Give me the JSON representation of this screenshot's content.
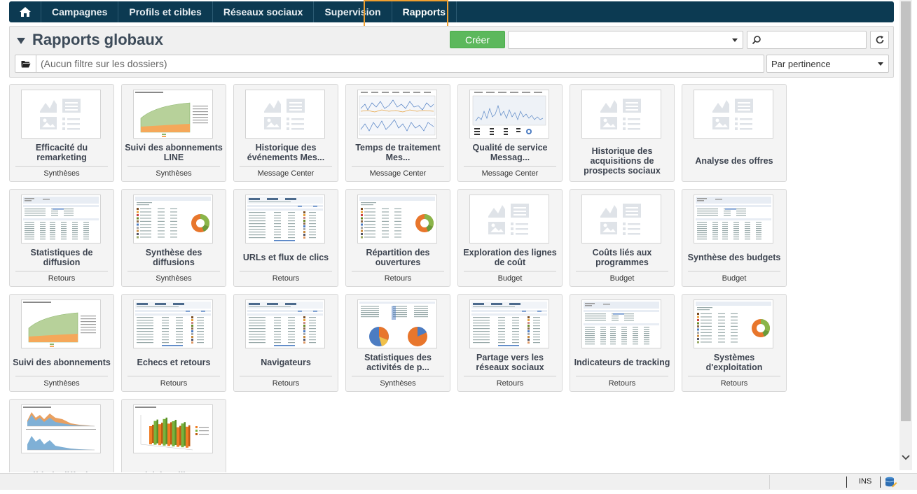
{
  "nav": {
    "home_icon": "home-icon",
    "tabs": [
      {
        "label": "Campagnes"
      },
      {
        "label": "Profils et cibles"
      },
      {
        "label": "Réseaux sociaux"
      },
      {
        "label": "Supervision"
      },
      {
        "label": "Rapports",
        "active": true
      }
    ]
  },
  "header": {
    "title": "Rapports globaux",
    "create_label": "Créer",
    "folder_filter": "(Aucun filtre sur les dossiers)",
    "sort_value": "Par pertinence",
    "type_select_value": ""
  },
  "cards": [
    {
      "title": "Efficacité du remarketing",
      "category": "Synthèses",
      "thumb": "placeholder"
    },
    {
      "title": "Suivi des abonnements LINE",
      "category": "Synthèses",
      "thumb": "area"
    },
    {
      "title": "Historique des événements Mes...",
      "category": "Message Center",
      "thumb": "placeholder"
    },
    {
      "title": "Temps de traitement Mes...",
      "category": "Message Center",
      "thumb": "timeseries"
    },
    {
      "title": "Qualité de service Messag...",
      "category": "Message Center",
      "thumb": "quality"
    },
    {
      "title": "Historique des acquisitions de prospects sociaux",
      "category": "",
      "thumb": "placeholder"
    },
    {
      "title": "Analyse des offres",
      "category": "",
      "thumb": "placeholder"
    },
    {
      "title": "Statistiques de diffusion",
      "category": "Retours",
      "thumb": "table"
    },
    {
      "title": "Synthèse des diffusions",
      "category": "Synthèses",
      "thumb": "donut"
    },
    {
      "title": "URLs et flux de clics",
      "category": "Retours",
      "thumb": "stats"
    },
    {
      "title": "Répartition des ouvertures",
      "category": "Retours",
      "thumb": "donut"
    },
    {
      "title": "Exploration des lignes de coût",
      "category": "Budget",
      "thumb": "placeholder"
    },
    {
      "title": "Coûts liés aux programmes",
      "category": "Budget",
      "thumb": "placeholder"
    },
    {
      "title": "Synthèse des budgets",
      "category": "Budget",
      "thumb": "table"
    },
    {
      "title": "Suivi des abonnements",
      "category": "Synthèses",
      "thumb": "area"
    },
    {
      "title": "Echecs et retours",
      "category": "Retours",
      "thumb": "stats"
    },
    {
      "title": "Navigateurs",
      "category": "Retours",
      "thumb": "stats"
    },
    {
      "title": "Statistiques des activités de p...",
      "category": "Synthèses",
      "thumb": "pies"
    },
    {
      "title": "Partage vers les réseaux sociaux",
      "category": "Retours",
      "thumb": "stats"
    },
    {
      "title": "Indicateurs de tracking",
      "category": "Retours",
      "thumb": "table"
    },
    {
      "title": "Systèmes d'exploitation",
      "category": "Retours",
      "thumb": "donut"
    },
    {
      "title": "Débit de diffusion",
      "category": "",
      "thumb": "mountain"
    },
    {
      "title": "Activités utilisateurs",
      "category": "",
      "thumb": "bars3d"
    }
  ],
  "status": {
    "mode": "INS",
    "db_icon": "database-icon"
  },
  "colors": {
    "nav_bg": "#0c3a52",
    "create_green": "#5cb85c",
    "highlight": "#f0a030"
  }
}
